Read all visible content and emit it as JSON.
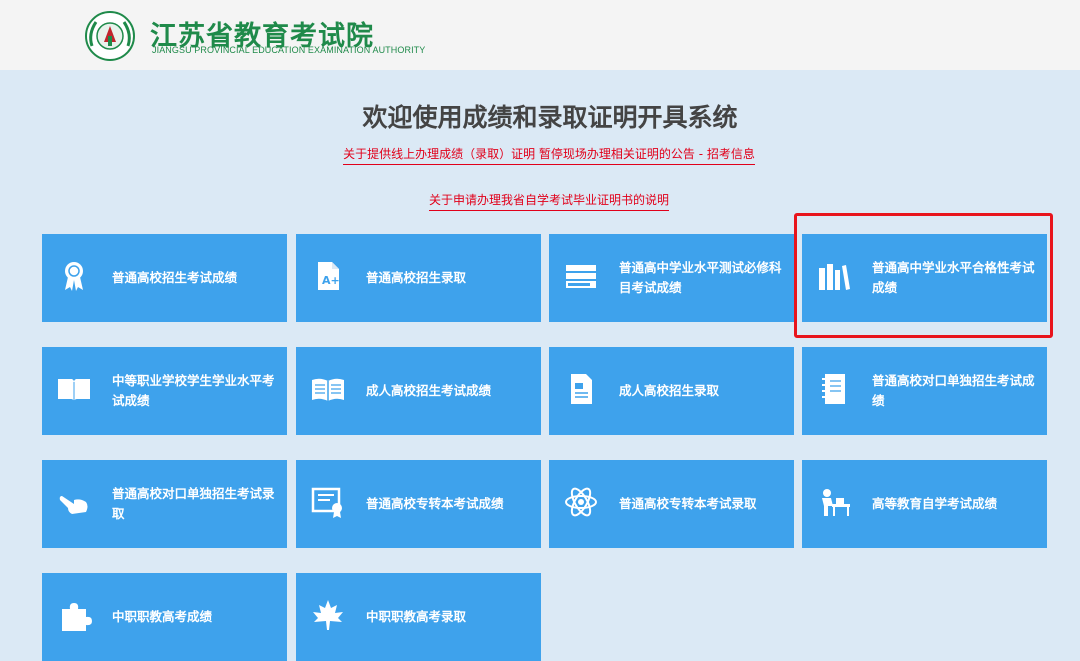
{
  "header": {
    "logo_cn": "江苏省教育考试院",
    "logo_en": "JIANGSU PROVINCIAL EDUCATION EXAMINATION AUTHORITY"
  },
  "main": {
    "title": "欢迎使用成绩和录取证明开具系统",
    "notices": [
      "关于提供线上办理成绩（录取）证明 暂停现场办理相关证明的公告 - 招考信息",
      "关于申请办理我省自学考试毕业证明书的说明"
    ]
  },
  "tiles": [
    {
      "label": "普通高校招生考试成绩",
      "icon": "award-ribbon-icon"
    },
    {
      "label": "普通高校招生录取",
      "icon": "grade-document-icon"
    },
    {
      "label": "普通高中学业水平测试必修科目考试成绩",
      "icon": "book-stack-icon"
    },
    {
      "label": "普通高中学业水平合格性考试成绩",
      "icon": "bookshelf-icon"
    },
    {
      "label": "中等职业学校学生学业水平考试成绩",
      "icon": "open-book-icon"
    },
    {
      "label": "成人高校招生考试成绩",
      "icon": "reading-book-icon"
    },
    {
      "label": "成人高校招生录取",
      "icon": "document-icon"
    },
    {
      "label": "普通高校对口单独招生考试成绩",
      "icon": "notebook-icon"
    },
    {
      "label": "普通高校对口单独招生考试录取",
      "icon": "pointing-hand-icon"
    },
    {
      "label": "普通高校专转本考试成绩",
      "icon": "certificate-icon"
    },
    {
      "label": "普通高校专转本考试录取",
      "icon": "atom-icon"
    },
    {
      "label": "高等教育自学考试成绩",
      "icon": "student-desk-icon"
    },
    {
      "label": "中职职教高考成绩",
      "icon": "puzzle-icon"
    },
    {
      "label": "中职职教高考录取",
      "icon": "maple-leaf-icon"
    }
  ],
  "colors": {
    "page_bg": "#dbe9f5",
    "header_bg": "#f4f4f4",
    "tile_bg": "#3ea2ec",
    "brand_green": "#1f8a4a",
    "notice_red": "#e1001a",
    "highlight_red": "#e8141c"
  }
}
